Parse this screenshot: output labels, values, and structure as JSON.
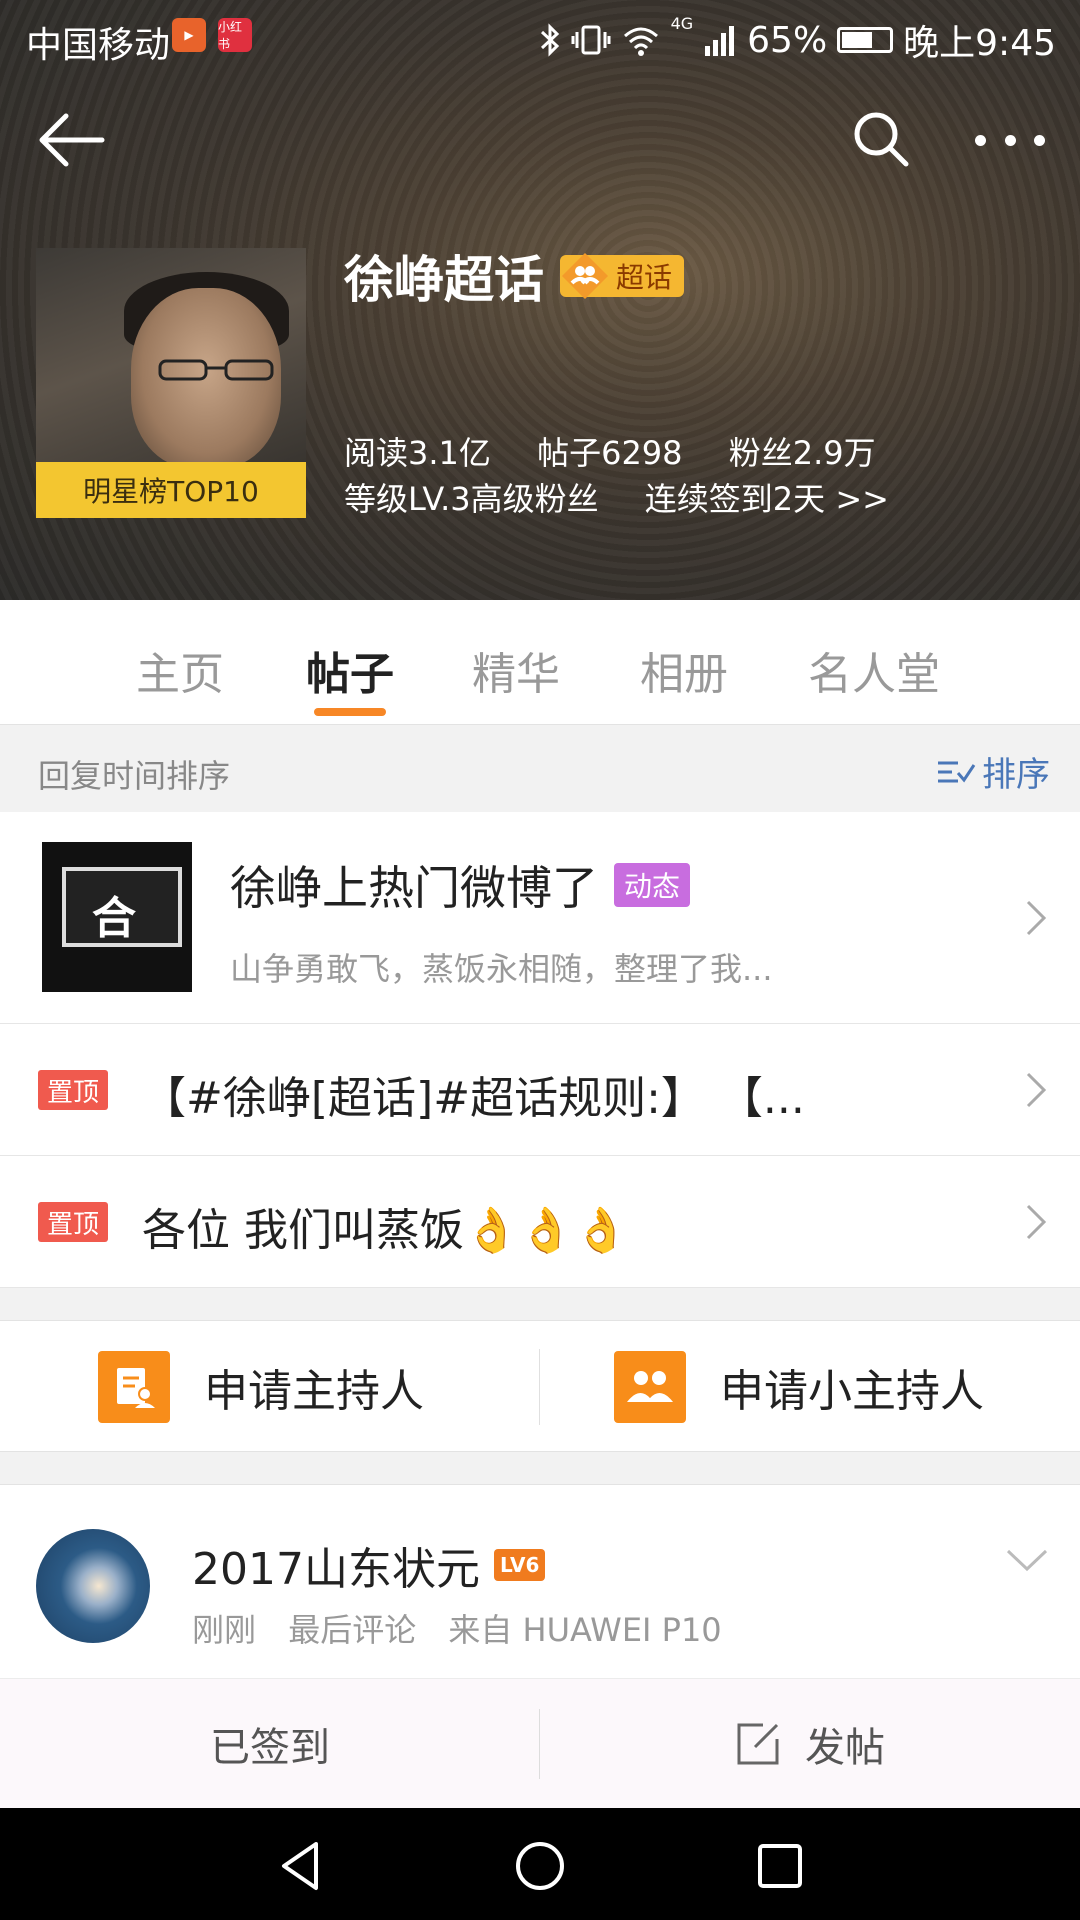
{
  "status_bar": {
    "carrier": "中国移动",
    "badge1": "▶",
    "badge2": "小红书",
    "network": "4G",
    "battery": "65%",
    "time": "晚上9:45"
  },
  "header": {
    "title": "徐峥超话",
    "badge_label": "超话",
    "avatar_label": "明星榜TOP10",
    "stats": {
      "reads": "阅读3.1亿",
      "posts": "帖子6298",
      "fans": "粉丝2.9万",
      "level": "等级LV.3高级粉丝",
      "checkin": "连续签到2天 >>"
    }
  },
  "tabs": [
    {
      "label": "主页"
    },
    {
      "label": "帖子"
    },
    {
      "label": "精华"
    },
    {
      "label": "相册"
    },
    {
      "label": "名人堂"
    }
  ],
  "sort": {
    "label": "回复时间排序",
    "button": "排序"
  },
  "posts": {
    "featured": {
      "title": "徐峥上热门微博了",
      "tag": "动态",
      "summary": "山争勇敢飞，蒸饭永相随，整理了我...",
      "thumb_symbol": "合"
    },
    "pinned": [
      {
        "badge": "置顶",
        "text": "【#徐峥[超话]#超话规则:】 【..."
      },
      {
        "badge": "置顶",
        "text": "各位 我们叫蒸饭👌👌👌"
      }
    ]
  },
  "host_actions": {
    "apply_host": "申请主持人",
    "apply_sub_host": "申请小主持人"
  },
  "user_post": {
    "username": "2017山东状元",
    "level_badge": "LV6",
    "time": "刚刚",
    "action": "最后评论",
    "source": "来自 HUAWEI P10"
  },
  "bottom_bar": {
    "signed": "已签到",
    "post": "发帖"
  },
  "colors": {
    "accent_orange": "#f78726",
    "pin_red": "#f05a4e",
    "dynamic_purple": "#c86ddf",
    "sort_blue": "#4a77b8",
    "top10_yellow": "#f3c630"
  }
}
